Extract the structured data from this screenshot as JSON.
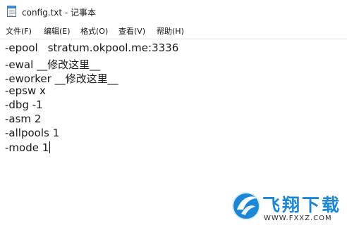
{
  "window": {
    "title": "config.txt - 记事本"
  },
  "menu": [
    {
      "label": "文件(F)"
    },
    {
      "label": "编辑(E)"
    },
    {
      "label": "格式(O)"
    },
    {
      "label": "查看(V)"
    },
    {
      "label": "帮助(H)"
    }
  ],
  "editor": {
    "lines": [
      {
        "key": "-epool",
        "value": "stratum.okpool.me:3336"
      },
      {
        "key": "-ewal",
        "value": "__修改这里__"
      },
      {
        "key": "-eworker",
        "value": "__修改这里__"
      },
      {
        "key": "-epsw",
        "value": "x"
      },
      {
        "key": "-dbg",
        "value": "-1"
      },
      {
        "key": "-asm",
        "value": "2"
      },
      {
        "key": "-allpools",
        "value": "1"
      },
      {
        "key": "-mode",
        "value": "1"
      }
    ]
  },
  "watermark": {
    "brand": "飞翔下载",
    "url": "WWW.FXXZ.COM",
    "color": "#1b87d6"
  },
  "icons": {
    "app_icon": "notepad-icon",
    "watermark_logo": "fxxz-logo-icon"
  }
}
